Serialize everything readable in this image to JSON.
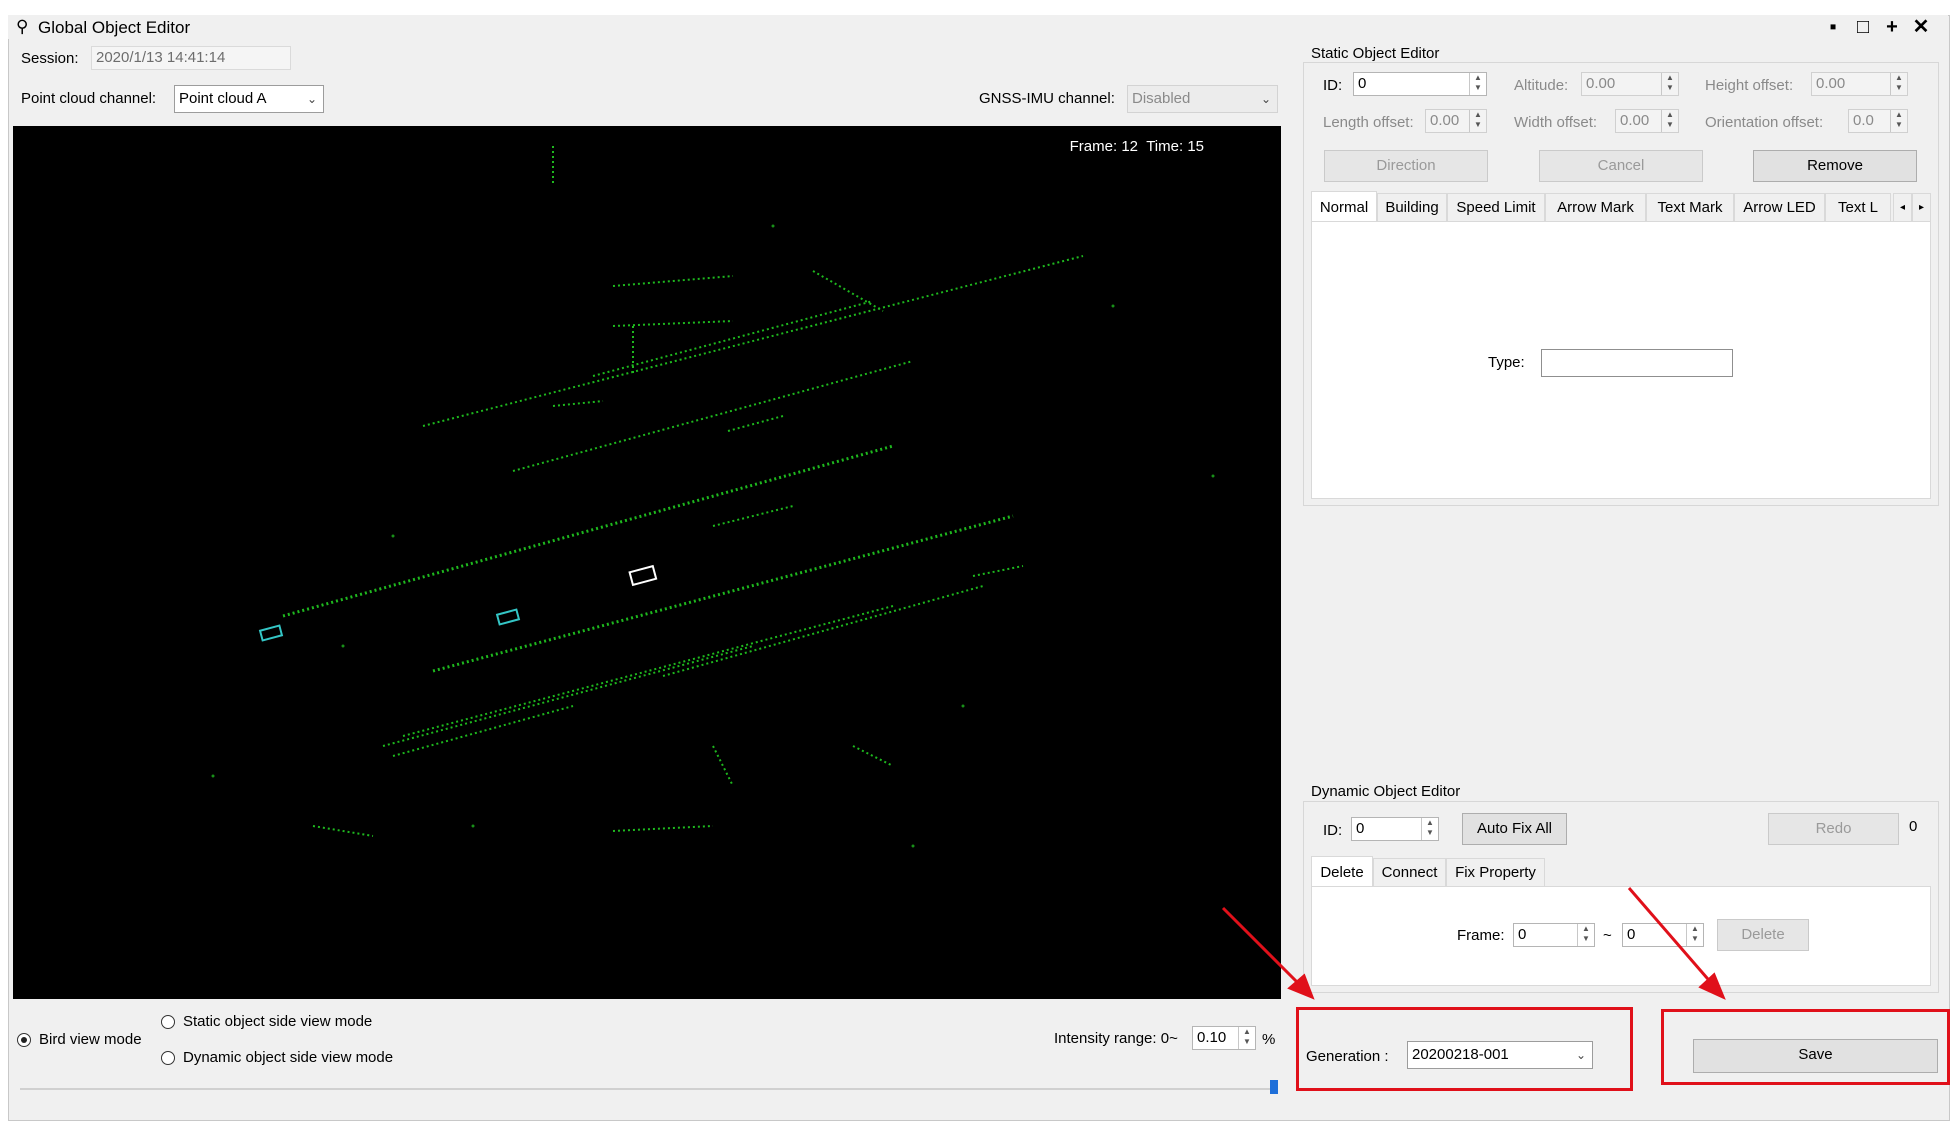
{
  "window": {
    "title": "Global Object Editor",
    "controls": [
      "minimize",
      "maximize",
      "pin",
      "close"
    ]
  },
  "toolbar": {
    "session_label": "Session:",
    "session_value": "2020/1/13 14:41:14",
    "pointcloud_label": "Point cloud channel:",
    "pointcloud_value": "Point cloud A",
    "gnss_label": "GNSS-IMU channel:",
    "gnss_value": "Disabled"
  },
  "viewport": {
    "frame_text": "Frame: 12",
    "time_text": "Time: 15"
  },
  "view_modes": {
    "bird": "Bird view mode",
    "static": "Static object side view mode",
    "dynamic": "Dynamic object side view mode",
    "selected": "bird"
  },
  "intensity": {
    "label": "Intensity range: 0~",
    "value": "0.10",
    "unit": "%"
  },
  "static_editor": {
    "title": "Static Object Editor",
    "id_label": "ID:",
    "id_value": "0",
    "altitude_label": "Altitude:",
    "altitude_value": "0.00",
    "height_label": "Height offset:",
    "height_value": "0.00",
    "length_label": "Length offset:",
    "length_value": "0.00",
    "width_label": "Width offset:",
    "width_value": "0.00",
    "orientation_label": "Orientation offset:",
    "orientation_value": "0.0",
    "buttons": {
      "direction": "Direction",
      "cancel": "Cancel",
      "remove": "Remove"
    },
    "tabs": [
      "Normal",
      "Building",
      "Speed Limit",
      "Arrow Mark",
      "Text Mark",
      "Arrow LED",
      "Text L"
    ],
    "active_tab": "Normal",
    "type_label": "Type:",
    "type_value": ""
  },
  "dynamic_editor": {
    "title": "Dynamic Object Editor",
    "id_label": "ID:",
    "id_value": "0",
    "auto_fix": "Auto Fix All",
    "redo": "Redo",
    "redo_count": "0",
    "tabs": [
      "Delete",
      "Connect",
      "Fix Property"
    ],
    "active_tab": "Delete",
    "frame_label": "Frame:",
    "frame_from": "0",
    "frame_tilde": "~",
    "frame_to": "0",
    "delete_button": "Delete"
  },
  "generation": {
    "label": "Generation :",
    "value": "20200218-001"
  },
  "save_button": "Save",
  "colors": {
    "highlight": "#e0101a",
    "points": "#22cc22",
    "viewport_bg": "#000000"
  }
}
